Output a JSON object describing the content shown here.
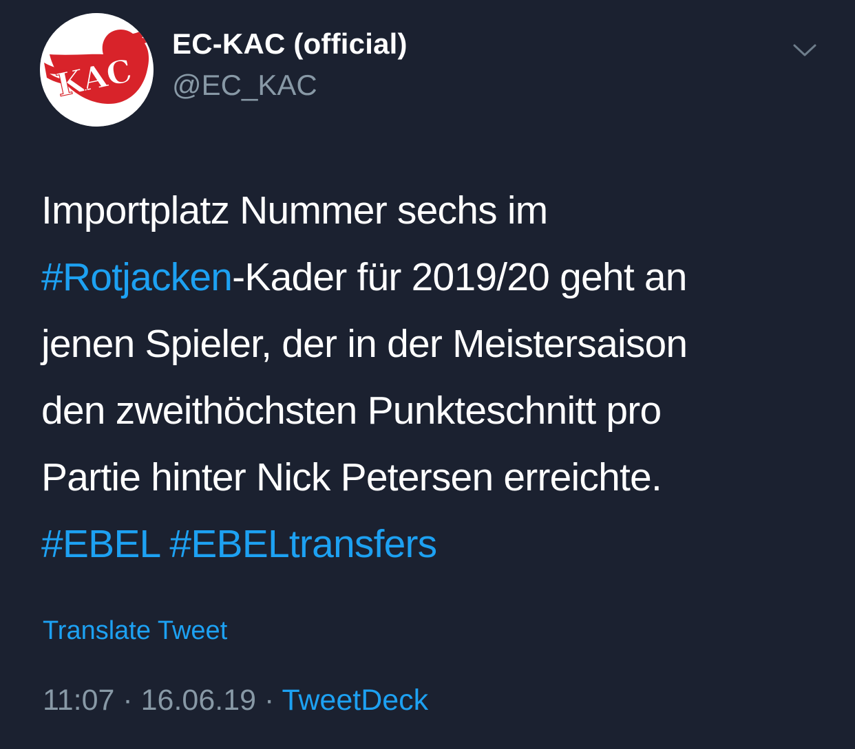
{
  "account": {
    "display_name": "EC-KAC (official)",
    "handle": "@EC_KAC",
    "avatar_icon": "kac-bird-logo-icon",
    "avatar_colors": {
      "background": "#ffffff",
      "bird": "#d8232a"
    }
  },
  "menu": {
    "icon": "chevron-down-icon"
  },
  "tweet": {
    "lines": [
      [
        {
          "text": "Importplatz Nummer sechs im",
          "type": "text"
        }
      ],
      [
        {
          "text": "#Rotjacken",
          "type": "hashtag"
        },
        {
          "text": "-Kader für 2019/20 geht an",
          "type": "text"
        }
      ],
      [
        {
          "text": "jenen Spieler, der in der Meistersaison",
          "type": "text"
        }
      ],
      [
        {
          "text": "den zweithöchsten Punkteschnitt pro",
          "type": "text"
        }
      ],
      [
        {
          "text": "Partie hinter Nick Petersen erreichte.",
          "type": "text"
        }
      ],
      [
        {
          "text": "#EBEL",
          "type": "hashtag"
        },
        {
          "text": " ",
          "type": "text"
        },
        {
          "text": "#EBELtransfers",
          "type": "hashtag"
        }
      ]
    ]
  },
  "translate_label": "Translate Tweet",
  "meta": {
    "time": "11:07",
    "separator": " · ",
    "date": "16.06.19",
    "source": "TweetDeck"
  },
  "colors": {
    "background": "#1b2130",
    "link": "#1da1f2",
    "secondary_text": "#8899a6",
    "primary_text": "#ffffff"
  }
}
